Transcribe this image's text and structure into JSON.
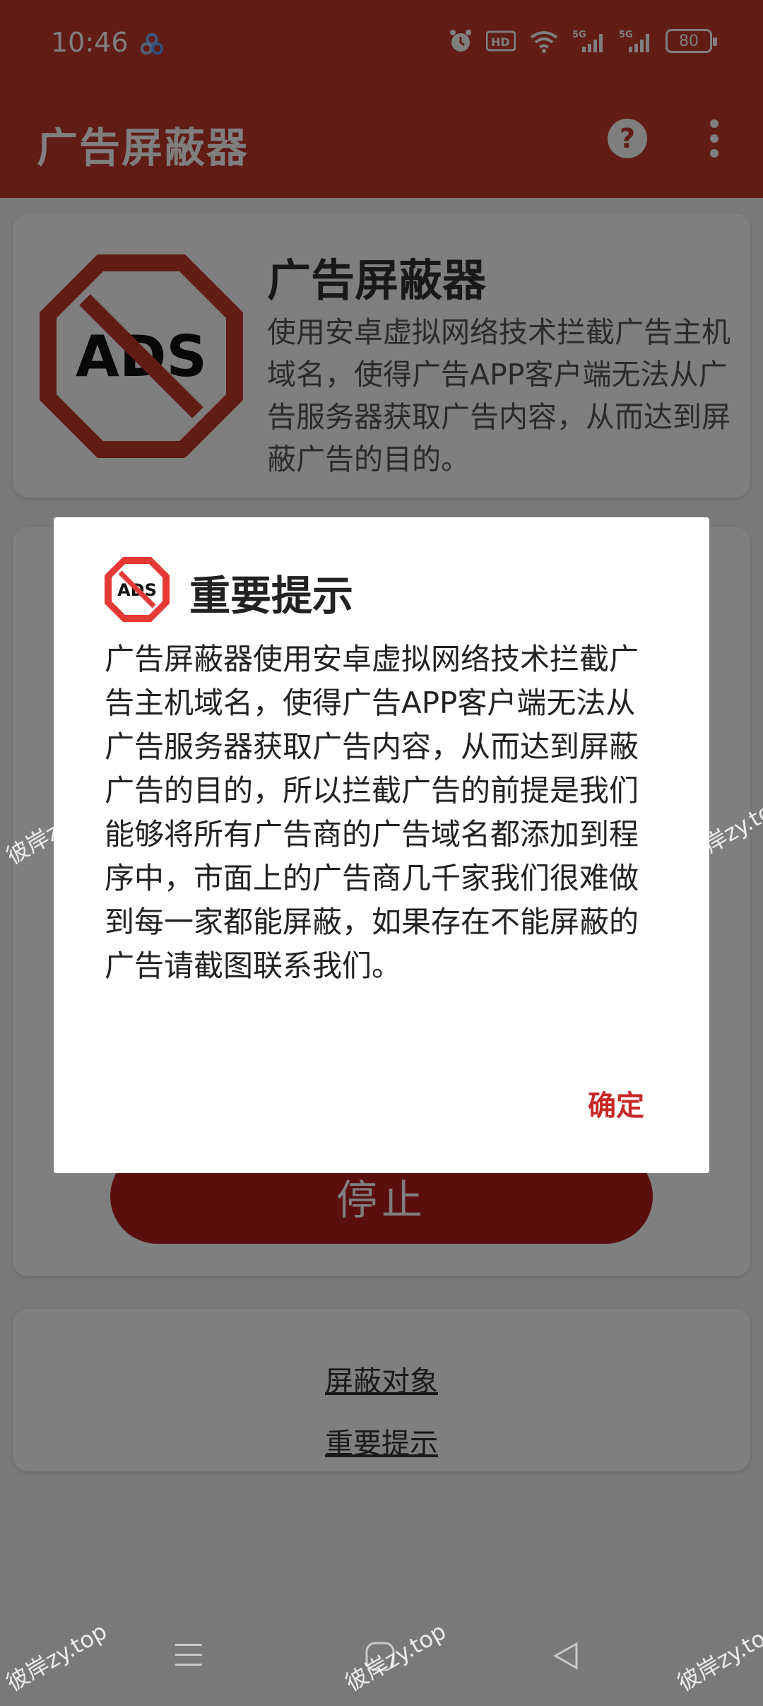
{
  "status_bar": {
    "time": "10:46",
    "battery": "80",
    "hd_label": "HD",
    "network_label": "5G"
  },
  "app_bar": {
    "title": "广告屏蔽器"
  },
  "info_card": {
    "title": "广告屏蔽器",
    "description": "使用安卓虚拟网络技术拦截广告主机域名，使得广告APP客户端无法从广告服务器获取广告内容，从而达到屏蔽广告的目的。",
    "logo_text": "ADS"
  },
  "control_card": {
    "stop_label": "停止"
  },
  "links_card": {
    "block_targets": "屏蔽对象",
    "important_notice": "重要提示"
  },
  "dialog": {
    "title": "重要提示",
    "logo_text": "ADS",
    "body": "广告屏蔽器使用安卓虚拟网络技术拦截广告主机域名，使得广告APP客户端无法从广告服务器获取广告内容，从而达到屏蔽广告的目的，所以拦截广告的前提是我们能够将所有广告商的广告域名都添加到程序中，市面上的广告商几千家我们很难做到每一家都能屏蔽，如果存在不能屏蔽的广告请截图联系我们。",
    "ok_label": "确定"
  },
  "watermark": {
    "text": "彼岸zy.top"
  },
  "colors": {
    "brand_red": "#c0392b",
    "dark_red": "#b71c1c",
    "accent_red": "#c62828"
  }
}
